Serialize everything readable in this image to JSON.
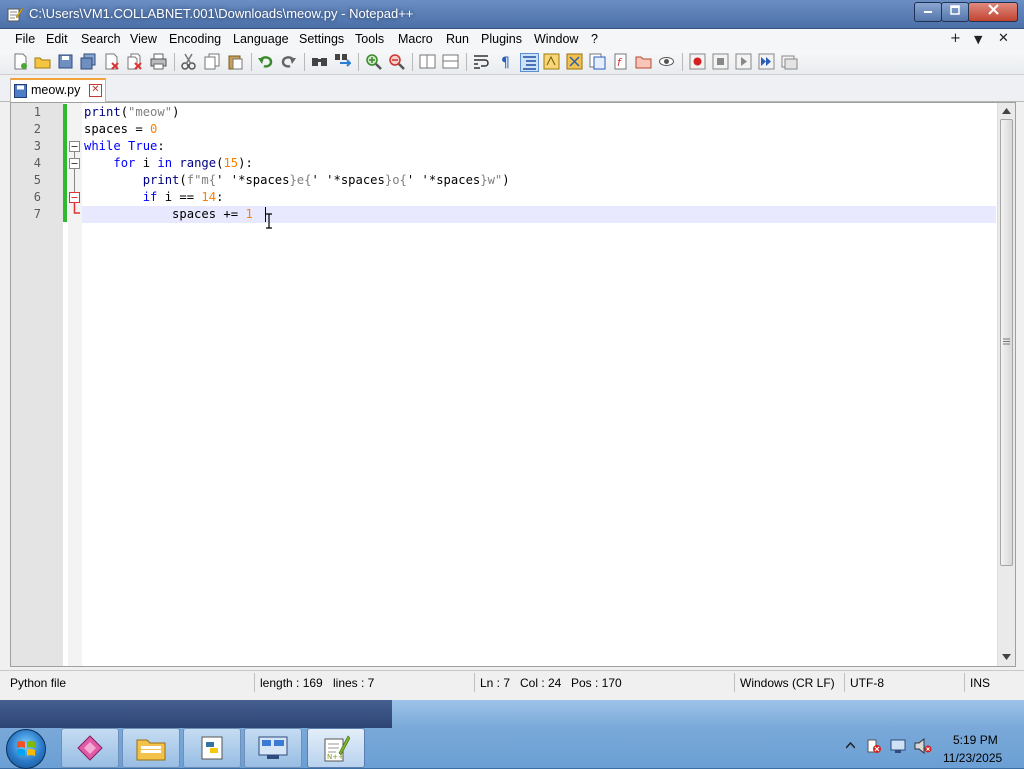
{
  "window": {
    "title": "C:\\Users\\VM1.COLLABNET.001\\Downloads\\meow.py - Notepad++",
    "minimize_icon": "minimize-icon",
    "maximize_icon": "maximize-icon",
    "close_icon": "close-icon"
  },
  "menu": {
    "items": [
      "File",
      "Edit",
      "Search",
      "View",
      "Encoding",
      "Language",
      "Settings",
      "Tools",
      "Macro",
      "Run",
      "Plugins",
      "Window",
      "?"
    ],
    "right": [
      "+",
      "▼",
      "✕"
    ]
  },
  "toolbar": {
    "icons": [
      "new-file-icon",
      "open-file-icon",
      "save-icon",
      "save-all-icon",
      "close-icon",
      "close-all-icon",
      "print-icon",
      "cut-icon",
      "copy-icon",
      "paste-icon",
      "undo-icon",
      "redo-icon",
      "find-icon",
      "replace-icon",
      "zoom-in-icon",
      "zoom-out-icon",
      "sync-vertical-icon",
      "sync-horizontal-icon",
      "word-wrap-icon",
      "show-all-chars-icon",
      "indent-guide-icon",
      "user-language-icon",
      "document-map-icon",
      "function-list-icon",
      "folder-as-workspace-icon",
      "monitoring-icon",
      "record-macro-icon",
      "stop-macro-icon",
      "play-macro-icon",
      "run-macro-multiple-icon",
      "save-macro-icon"
    ]
  },
  "tab": {
    "label": "meow.py",
    "close": "✕"
  },
  "editor": {
    "line_numbers": [
      "1",
      "2",
      "3",
      "4",
      "5",
      "6",
      "7"
    ],
    "lines": [
      "print(\"meow\")",
      "spaces = 0",
      "while True:",
      "    for i in range(15):",
      "        print(f\"m{' '*spaces}e{' '*spaces}o{' '*spaces}w\")",
      "        if i == 14:",
      "            spaces += 1"
    ]
  },
  "status": {
    "language": "Python file",
    "length": "length : 169",
    "lines": "lines : 7",
    "ln": "Ln : 7",
    "col": "Col : 24",
    "pos": "Pos : 170",
    "eol": "Windows (CR LF)",
    "encoding": "UTF-8",
    "mode": "INS"
  },
  "taskbar": {
    "apps": [
      "app-pink-icon",
      "explorer-icon",
      "python-icon",
      "network-icon",
      "notepadpp-icon"
    ],
    "tray_icons": [
      "show-hidden-icons-icon",
      "action-center-icon",
      "network-status-icon",
      "volume-muted-icon"
    ],
    "time": "5:19 PM",
    "date": "11/23/2025"
  }
}
